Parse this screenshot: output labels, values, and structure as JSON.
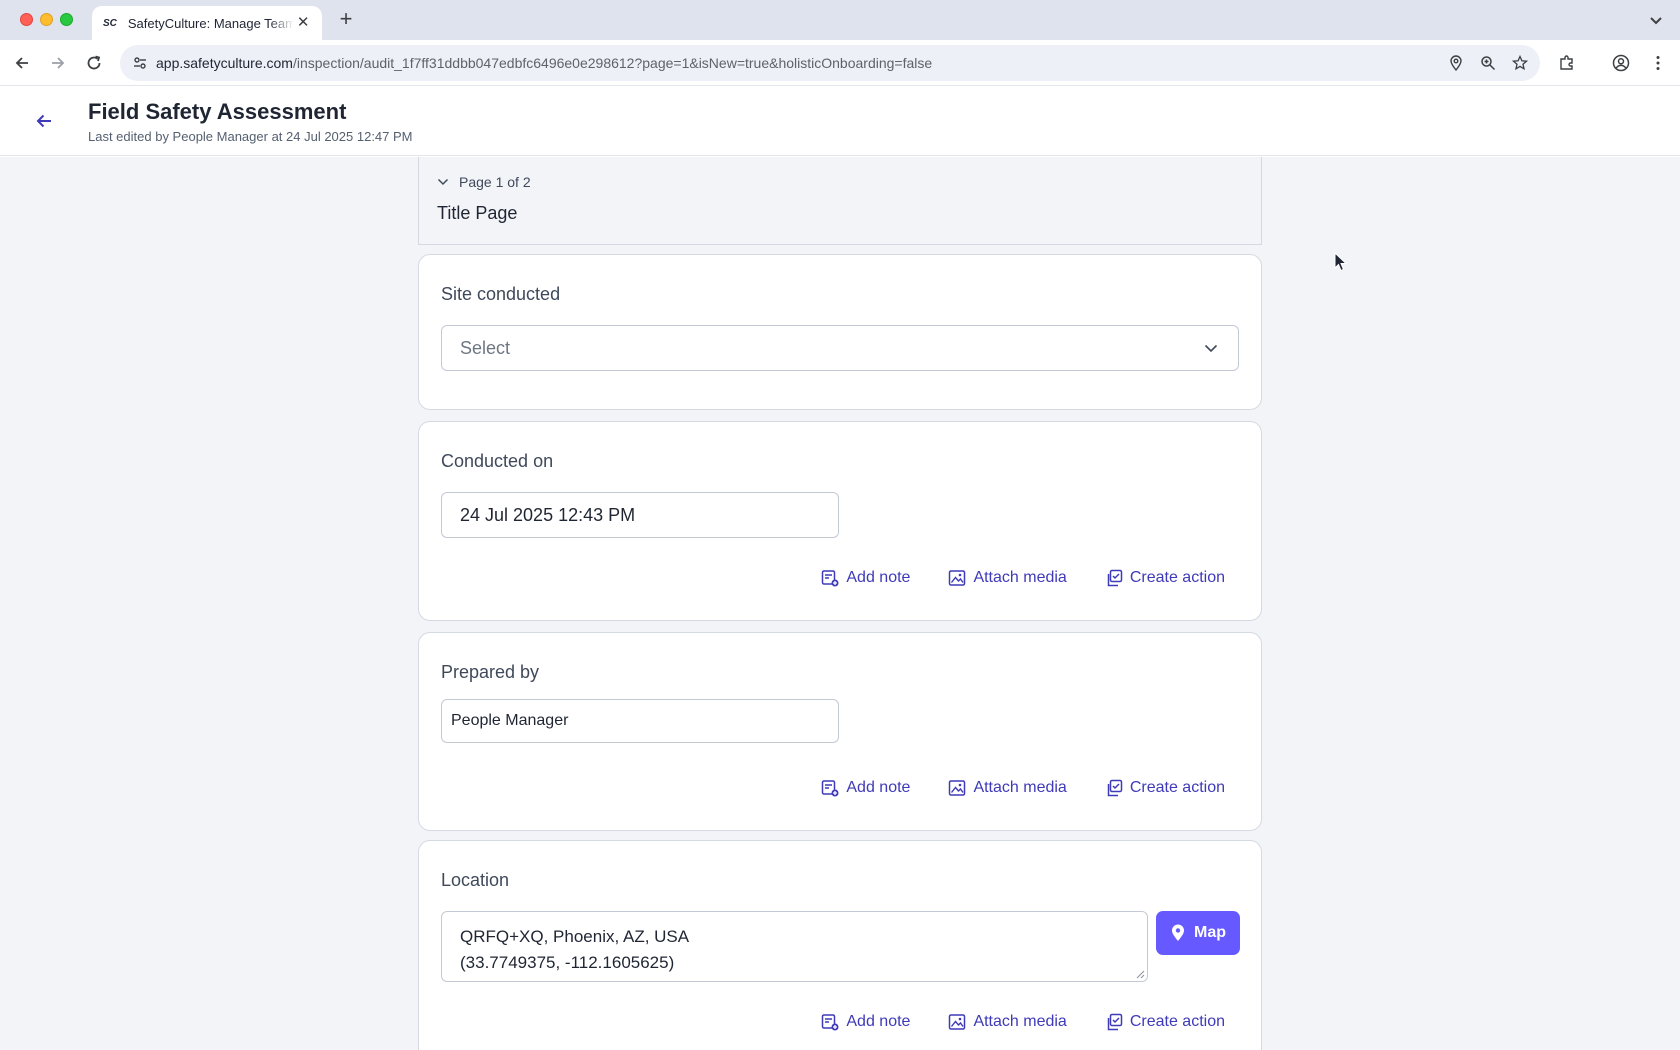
{
  "browser": {
    "tab_favicon": "SC",
    "tab_title": "SafetyCulture: Manage Teams and Inspections",
    "url_host": "app.safetyculture.com",
    "url_path": "/inspection/audit_1f7ff31ddbb047edbfc6496e0e298612?page=1&isNew=true&holisticOnboarding=false"
  },
  "header": {
    "title": "Field Safety Assessment",
    "subtitle": "Last edited by People Manager at 24 Jul 2025 12:47 PM"
  },
  "page_nav": {
    "page_indicator": "Page 1 of 2",
    "page_name": "Title Page"
  },
  "fields": {
    "site": {
      "label": "Site conducted",
      "placeholder": "Select"
    },
    "conducted_on": {
      "label": "Conducted on",
      "value": "24 Jul 2025 12:43 PM"
    },
    "prepared_by": {
      "label": "Prepared by",
      "value": "People Manager"
    },
    "location": {
      "label": "Location",
      "address": "QRFQ+XQ, Phoenix, AZ, USA",
      "coordinates": "(33.7749375, -112.1605625)",
      "map_label": "Map"
    }
  },
  "actions": {
    "add_note": "Add note",
    "attach_media": "Attach media",
    "create_action": "Create action"
  },
  "colors": {
    "accent": "#6559ff",
    "link": "#3f3ab8",
    "page_bg": "#f3f4f8"
  }
}
